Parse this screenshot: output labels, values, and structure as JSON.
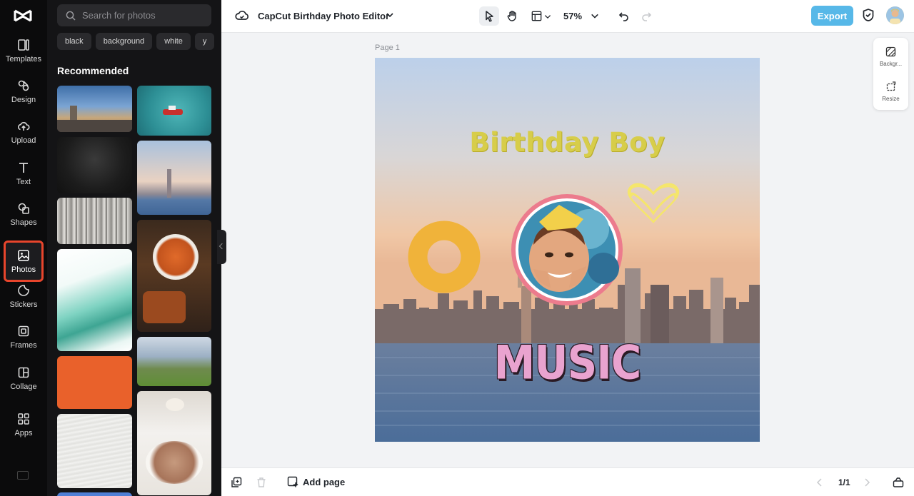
{
  "app": {
    "doc_title": "CapCut Birthday Photo Editor",
    "zoom": "57%",
    "export_label": "Export"
  },
  "rail": {
    "items": [
      {
        "label": "Templates",
        "icon": "templates-icon"
      },
      {
        "label": "Design",
        "icon": "design-icon"
      },
      {
        "label": "Upload",
        "icon": "upload-icon"
      },
      {
        "label": "Text",
        "icon": "text-icon"
      },
      {
        "label": "Shapes",
        "icon": "shapes-icon"
      },
      {
        "label": "Photos",
        "icon": "photos-icon",
        "active": true
      },
      {
        "label": "Stickers",
        "icon": "stickers-icon"
      },
      {
        "label": "Frames",
        "icon": "frames-icon"
      },
      {
        "label": "Collage",
        "icon": "collage-icon"
      },
      {
        "label": "Apps",
        "icon": "apps-icon"
      }
    ]
  },
  "panel": {
    "search_placeholder": "Search for photos",
    "chips": [
      "black",
      "background",
      "white",
      "y"
    ],
    "section_title": "Recommended"
  },
  "canvas": {
    "page_label": "Page 1",
    "headline": "Birthday Boy",
    "music_text": "MUSIC"
  },
  "side_tools": {
    "background_label": "Backgr...",
    "resize_label": "Resize"
  },
  "bottom": {
    "add_page_label": "Add page",
    "pager": "1/1"
  },
  "colors": {
    "accent_active": "#e8452c",
    "export_bg": "#57b8e8",
    "headline": "#d7cd4a",
    "donut": "#f0b33a",
    "frame_ring": "#ec7b8d",
    "music": "#e9a3cf"
  }
}
